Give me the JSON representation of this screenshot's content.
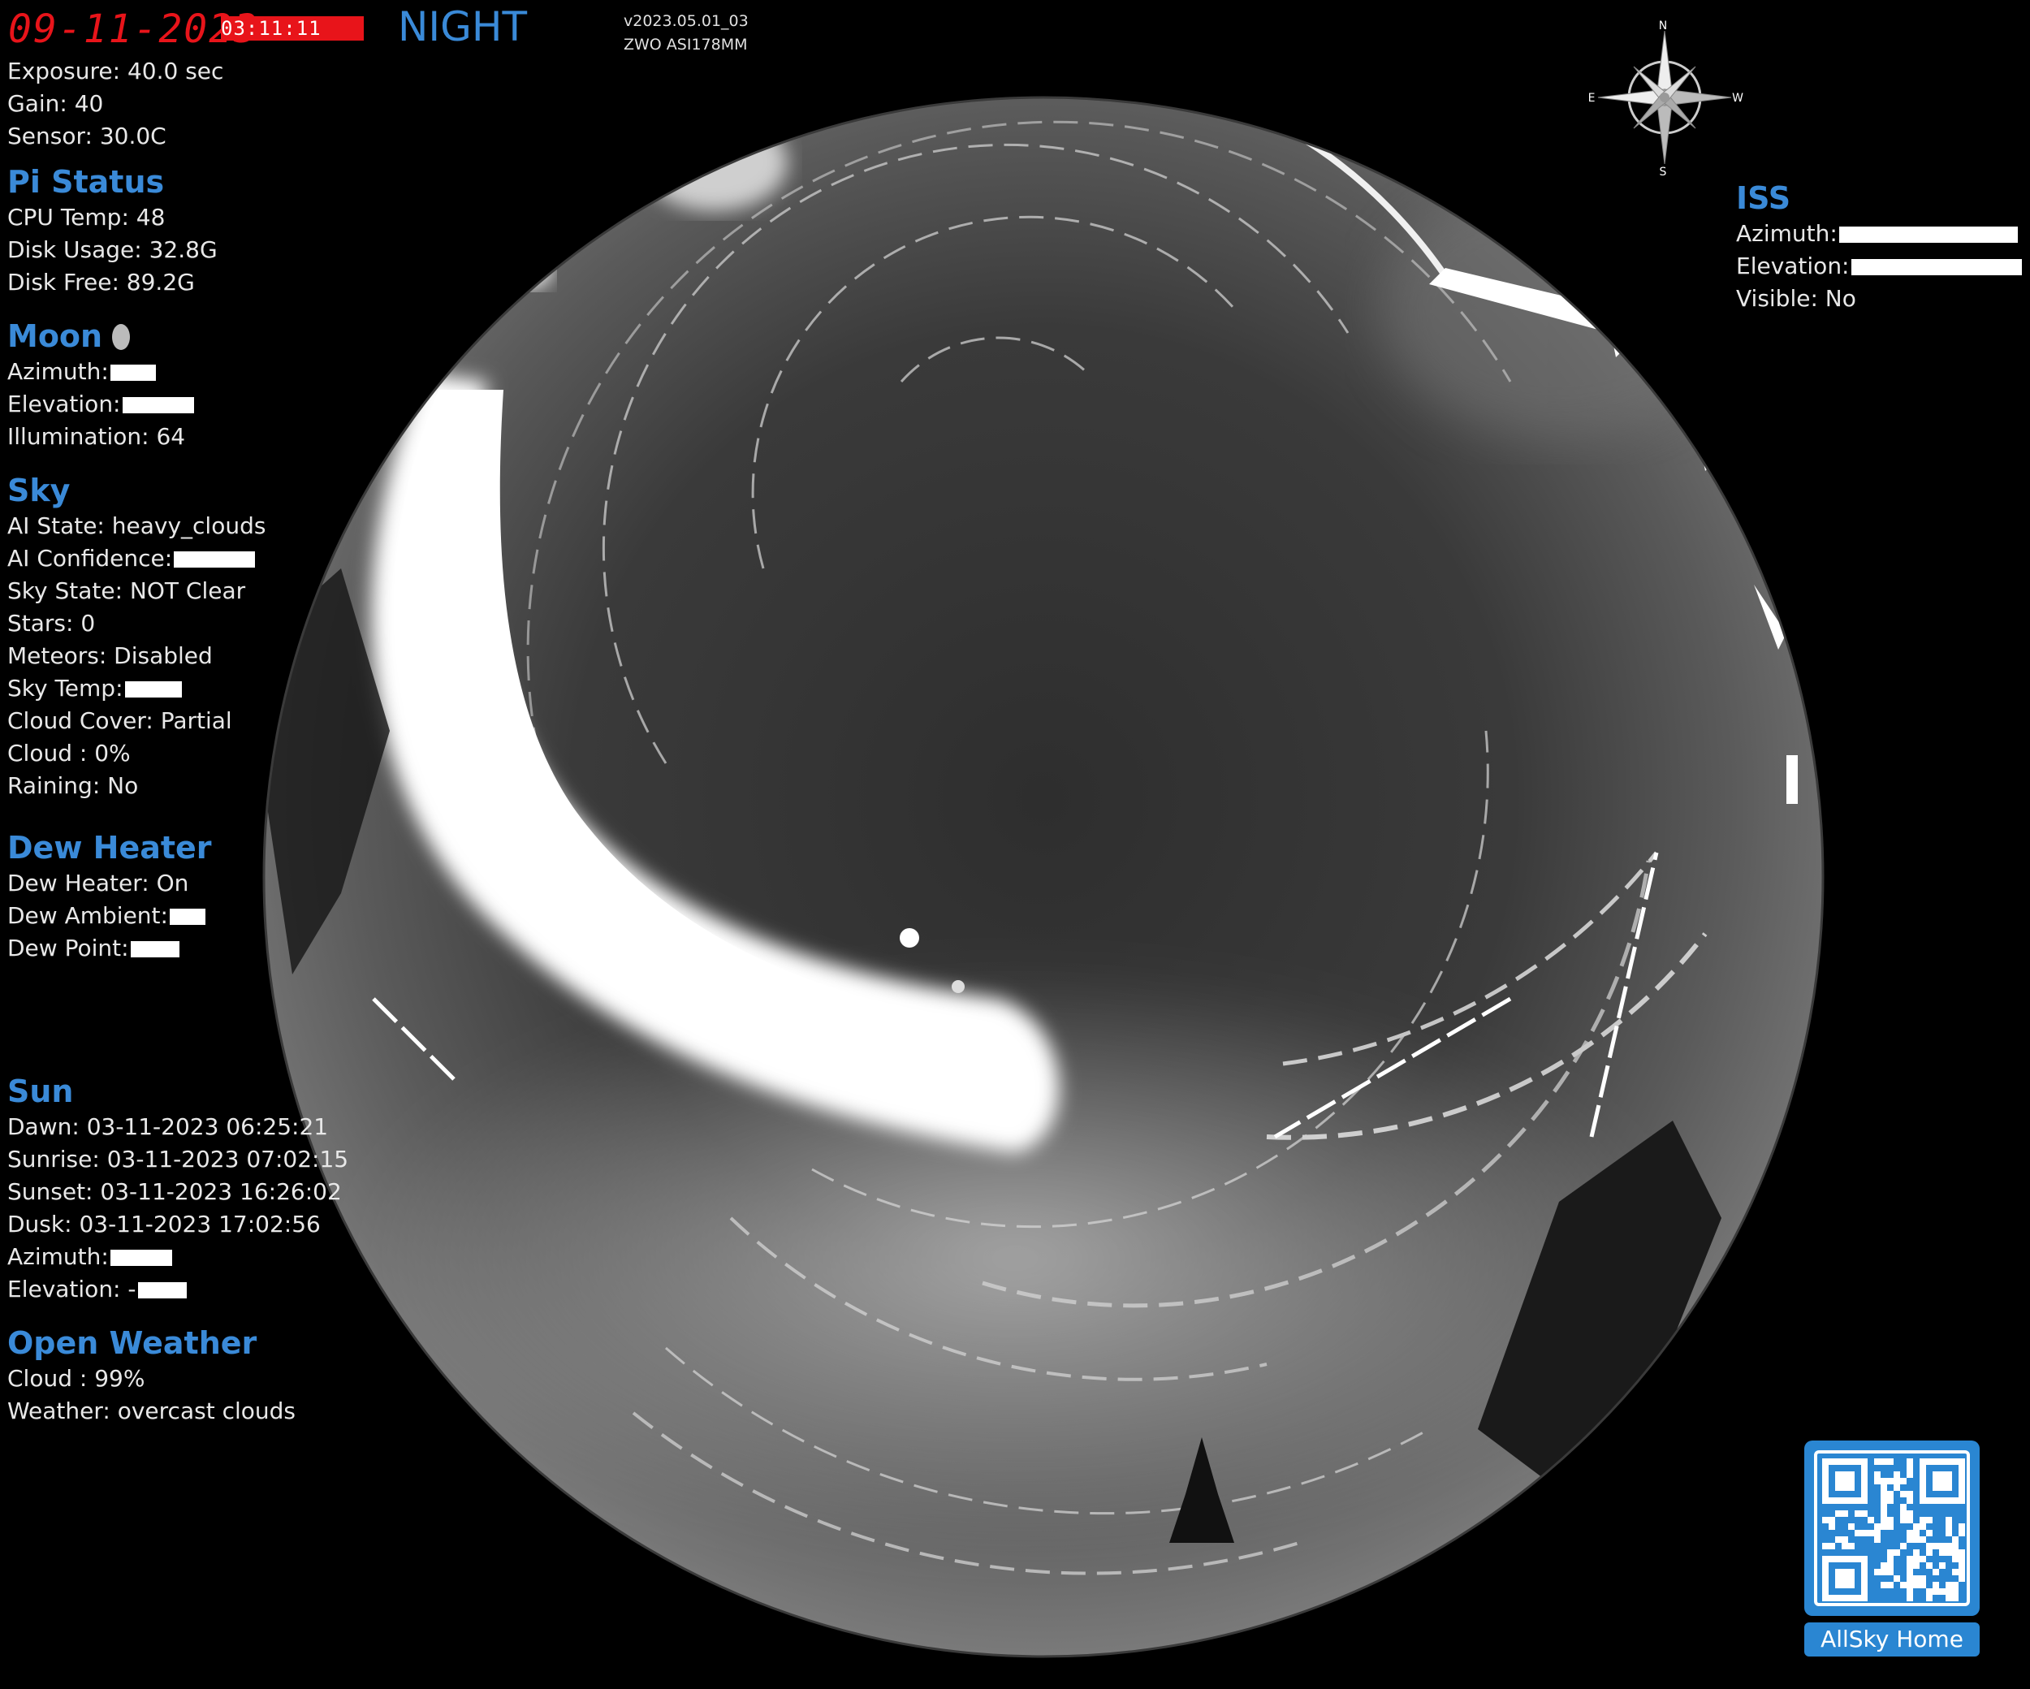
{
  "header": {
    "date": "09-11-2023",
    "time": "03:11:11",
    "mode": "NIGHT",
    "version": "v2023.05.01_03",
    "camera": "ZWO ASI178MM"
  },
  "camera": {
    "exposure": "Exposure: 40.0 sec",
    "gain": "Gain: 40",
    "sensor": "Sensor: 30.0C"
  },
  "pi_status": {
    "title": "Pi Status",
    "cpu_temp": "CPU Temp: 48",
    "disk_usage": "Disk Usage: 32.8G",
    "disk_free": "Disk Free: 89.2G"
  },
  "moon": {
    "title": "Moon",
    "azimuth": "Azimuth:",
    "elevation": "Elevation:",
    "illumination": "Illumination: 64"
  },
  "sky": {
    "title": "Sky",
    "ai_state": "AI State: heavy_clouds",
    "ai_confidence": "AI Confidence:",
    "sky_state": "Sky State: NOT Clear",
    "stars": "Stars: 0",
    "meteors": "Meteors: Disabled",
    "sky_temp": "Sky Temp:",
    "cloud_cover": "Cloud Cover: Partial",
    "cloud": "Cloud : 0%",
    "raining": "Raining: No"
  },
  "dew_heater": {
    "title": "Dew Heater",
    "status": "Dew Heater: On",
    "ambient": "Dew Ambient:",
    "dew_point": "Dew Point:"
  },
  "sun": {
    "title": "Sun",
    "dawn": "Dawn: 03-11-2023 06:25:21",
    "sunrise": "Sunrise: 03-11-2023 07:02:15",
    "sunset": "Sunset: 03-11-2023 16:26:02",
    "dusk": "Dusk: 03-11-2023 17:02:56",
    "azimuth": "Azimuth:",
    "elevation": "Elevation: -"
  },
  "open_weather": {
    "title": "Open Weather",
    "cloud": "Cloud : 99%",
    "weather": "Weather: overcast clouds"
  },
  "iss": {
    "title": "ISS",
    "azimuth": "Azimuth:",
    "elevation": "Elevation:",
    "visible": "Visible: No"
  },
  "compass": {
    "n": "N",
    "s": "S",
    "e": "E",
    "w": "W"
  },
  "qr": {
    "label": "AllSky Home"
  }
}
